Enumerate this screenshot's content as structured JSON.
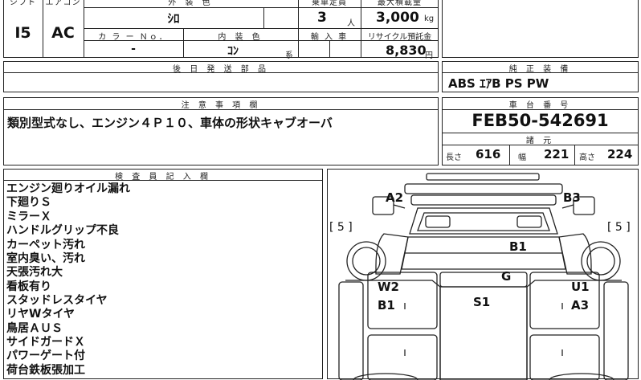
{
  "top": {
    "shift_label": "シフト",
    "aircon_label": "エアコン",
    "exterior_color_label": "外 装 色",
    "capacity_label": "乗車定員",
    "max_load_label": "最大積載量",
    "shift_value": "I5",
    "aircon_value": "AC",
    "exterior_color_value": "ｼﾛ",
    "capacity_value": "3",
    "capacity_unit": "人",
    "max_load_value": "3,000",
    "max_load_unit": "kg",
    "color_no_label": "カ ラ ー Ｎｏ．",
    "interior_color_label": "内 装 色",
    "import_label": "輸 入 車",
    "recycle_label": "リサイクル預託金",
    "color_no_value": "-",
    "interior_color_value": "ｺﾝ",
    "interior_color_suffix": "系",
    "recycle_value": "8,830",
    "recycle_unit": "円"
  },
  "later_parts": {
    "label": "後 日 発 送 部 品",
    "value": ""
  },
  "genuine": {
    "label": "純 正 装 備",
    "value": "ABS ｴｱB PS PW"
  },
  "notes": {
    "label": "注 意 事 項 欄",
    "text": "類別型式なし、エンジン４Ｐ１０、車体の形状キャブオーバ"
  },
  "chassis": {
    "label": "車 台 番 号",
    "number": "FEB50-542691",
    "specs_label": "諸 元",
    "length_label": "長さ",
    "length_value": "616",
    "width_label": "幅",
    "width_value": "221",
    "height_label": "高さ",
    "height_value": "224"
  },
  "inspector": {
    "label": "検 査 員 記 入 欄",
    "lines": [
      "エンジン廻りオイル漏れ",
      "下廻りＳ",
      "ミラーＸ",
      "ハンドルグリップ不良",
      "カーペット汚れ",
      "室内臭い、汚れ",
      "天張汚れ大",
      "看板有り",
      "スタッドレスタイヤ",
      "リヤWタイヤ",
      "鳥居ＡＵＳ",
      "サイドガードＸ",
      "パワーゲート付",
      "荷台鉄板張加工"
    ]
  },
  "diagram": {
    "left_tire": "[ 5 ]",
    "right_tire": "[ 5 ]",
    "marks": {
      "a2": "A2",
      "b3": "B3",
      "b1_top": "B1",
      "g": "G",
      "w2": "W2",
      "b1_left": "B1",
      "s1": "S1",
      "u1": "U1",
      "a3": "A3"
    }
  }
}
